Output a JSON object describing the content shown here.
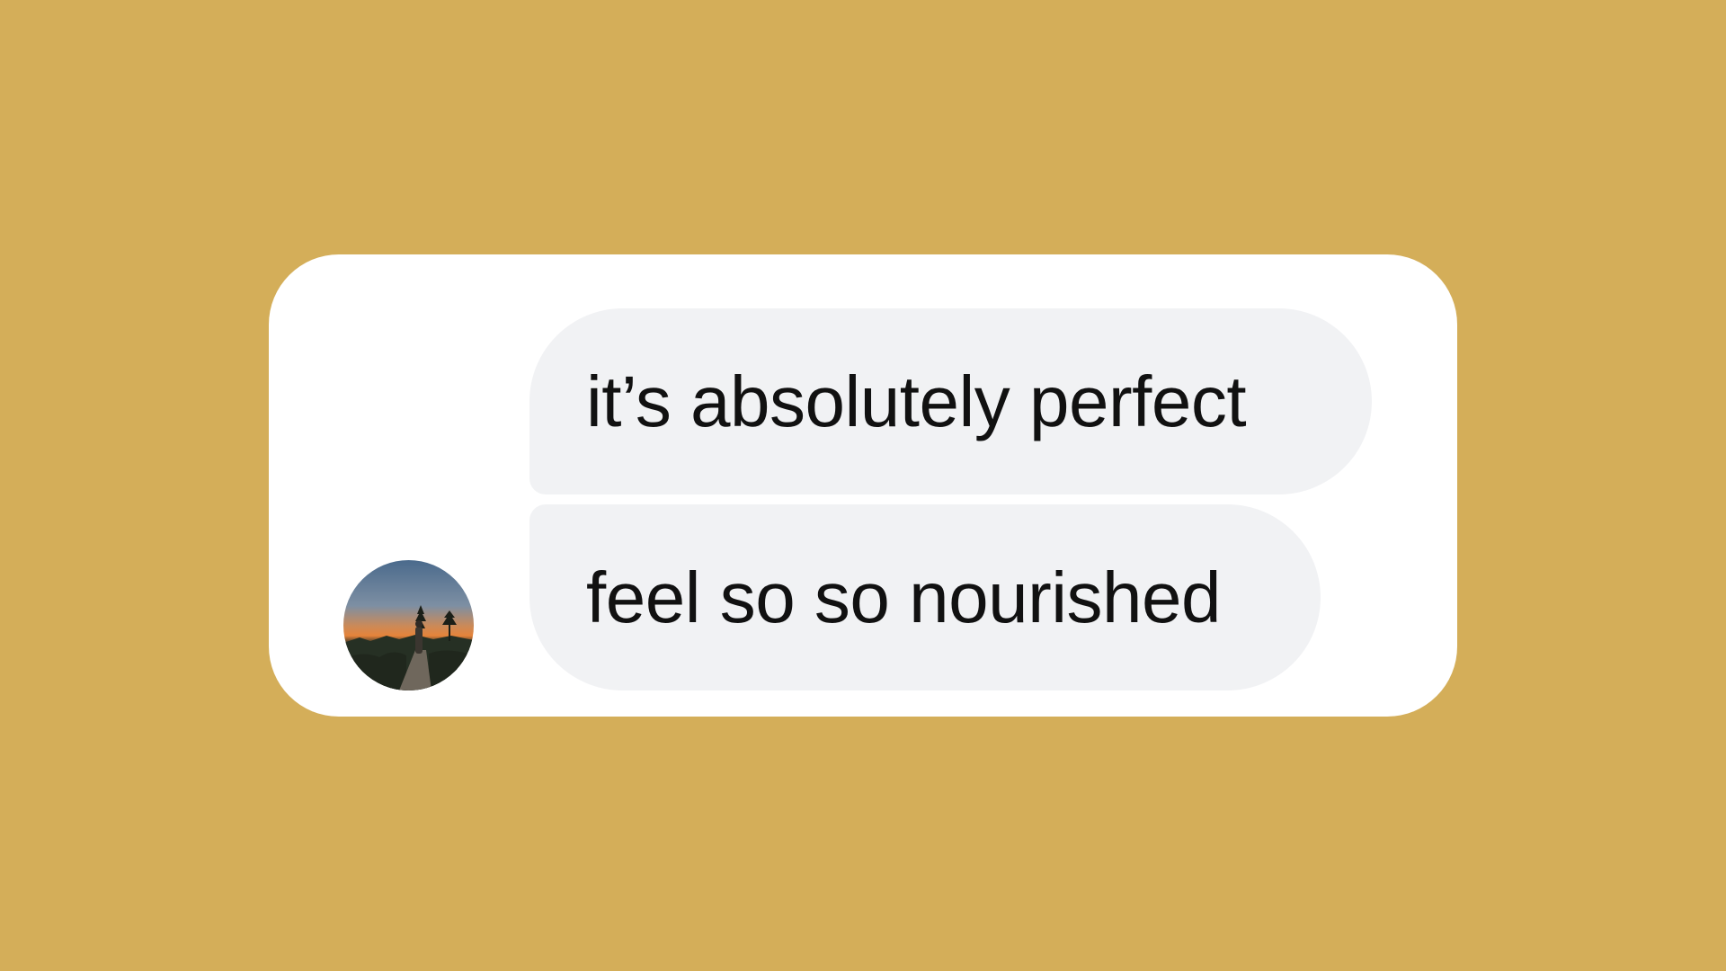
{
  "background_color": "#d4ae59",
  "card_color": "#ffffff",
  "bubble_color": "#f1f2f4",
  "text_color": "#111111",
  "conversation": {
    "avatar_icon": "profile-photo-sunset-silhouette",
    "messages": [
      {
        "text": "it’s absolutely perfect"
      },
      {
        "text": "feel so so nourished"
      }
    ]
  }
}
